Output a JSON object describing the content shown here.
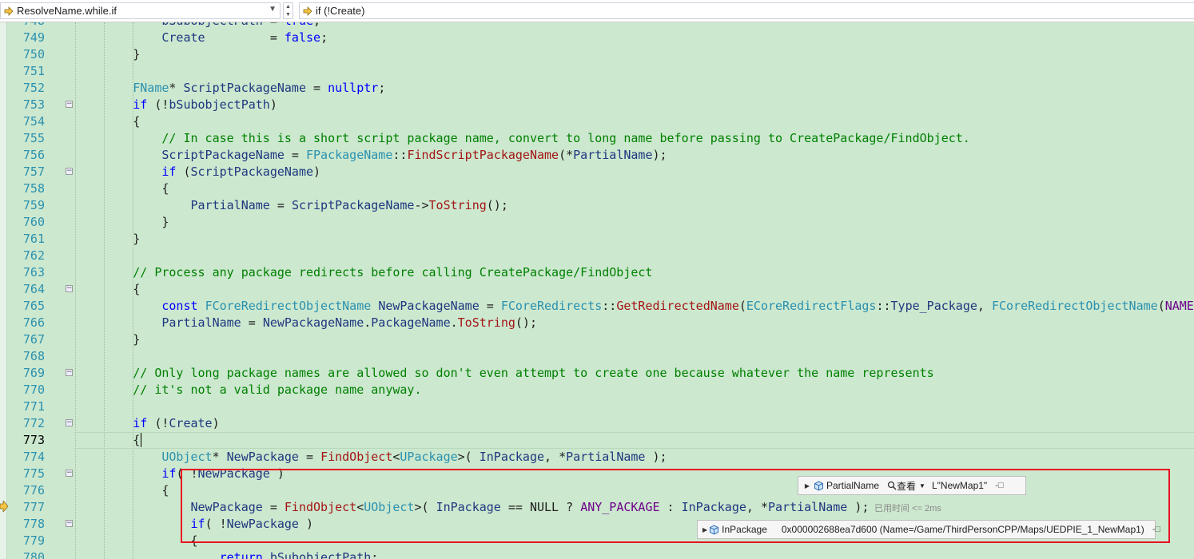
{
  "navbar": {
    "scope_combo": "ResolveName.while.if",
    "member_combo": "if (!Create)"
  },
  "code_lines": [
    {
      "num": "748",
      "cur": false,
      "fold": false,
      "segs": [
        [
          "",
          "            "
        ],
        [
          "va",
          "bSubobjectPath"
        ],
        [
          "",
          " = "
        ],
        [
          "kw",
          "true"
        ],
        [
          "",
          ";"
        ]
      ]
    },
    {
      "num": "749",
      "cur": false,
      "fold": false,
      "segs": [
        [
          "",
          "            "
        ],
        [
          "va",
          "Create"
        ],
        [
          "",
          "         = "
        ],
        [
          "kw",
          "false"
        ],
        [
          "",
          ";"
        ]
      ]
    },
    {
      "num": "750",
      "cur": false,
      "fold": false,
      "segs": [
        [
          "",
          "        }"
        ]
      ]
    },
    {
      "num": "751",
      "cur": false,
      "fold": false,
      "segs": []
    },
    {
      "num": "752",
      "cur": false,
      "fold": false,
      "segs": [
        [
          "",
          "        "
        ],
        [
          "ty",
          "FName"
        ],
        [
          "",
          "* "
        ],
        [
          "va",
          "ScriptPackageName"
        ],
        [
          "",
          " = "
        ],
        [
          "kw",
          "nullptr"
        ],
        [
          "",
          ";"
        ]
      ]
    },
    {
      "num": "753",
      "cur": false,
      "fold": true,
      "segs": [
        [
          "",
          "        "
        ],
        [
          "kw",
          "if"
        ],
        [
          "",
          " (!"
        ],
        [
          "va",
          "bSubobjectPath"
        ],
        [
          "",
          ")"
        ]
      ]
    },
    {
      "num": "754",
      "cur": false,
      "fold": false,
      "segs": [
        [
          "",
          "        {"
        ]
      ]
    },
    {
      "num": "755",
      "cur": false,
      "fold": false,
      "segs": [
        [
          "",
          "            "
        ],
        [
          "cm",
          "// In case this is a short script package name, convert to long name before passing to CreatePackage/FindObject."
        ]
      ]
    },
    {
      "num": "756",
      "cur": false,
      "fold": false,
      "segs": [
        [
          "",
          "            "
        ],
        [
          "va",
          "ScriptPackageName"
        ],
        [
          "",
          " = "
        ],
        [
          "ty",
          "FPackageName"
        ],
        [
          "",
          "::"
        ],
        [
          "fn",
          "FindScriptPackageName"
        ],
        [
          "",
          "(*"
        ],
        [
          "va",
          "PartialName"
        ],
        [
          "",
          ");"
        ]
      ]
    },
    {
      "num": "757",
      "cur": false,
      "fold": true,
      "segs": [
        [
          "",
          "            "
        ],
        [
          "kw",
          "if"
        ],
        [
          "",
          " ("
        ],
        [
          "va",
          "ScriptPackageName"
        ],
        [
          "",
          ")"
        ]
      ]
    },
    {
      "num": "758",
      "cur": false,
      "fold": false,
      "segs": [
        [
          "",
          "            {"
        ]
      ]
    },
    {
      "num": "759",
      "cur": false,
      "fold": false,
      "segs": [
        [
          "",
          "                "
        ],
        [
          "va",
          "PartialName"
        ],
        [
          "",
          " = "
        ],
        [
          "va",
          "ScriptPackageName"
        ],
        [
          "",
          "->"
        ],
        [
          "fn",
          "ToString"
        ],
        [
          "",
          "();"
        ]
      ]
    },
    {
      "num": "760",
      "cur": false,
      "fold": false,
      "segs": [
        [
          "",
          "            }"
        ]
      ]
    },
    {
      "num": "761",
      "cur": false,
      "fold": false,
      "segs": [
        [
          "",
          "        }"
        ]
      ]
    },
    {
      "num": "762",
      "cur": false,
      "fold": false,
      "segs": []
    },
    {
      "num": "763",
      "cur": false,
      "fold": false,
      "segs": [
        [
          "",
          "        "
        ],
        [
          "cm",
          "// Process any package redirects before calling CreatePackage/FindObject"
        ]
      ]
    },
    {
      "num": "764",
      "cur": false,
      "fold": true,
      "segs": [
        [
          "",
          "        {"
        ]
      ]
    },
    {
      "num": "765",
      "cur": false,
      "fold": false,
      "segs": [
        [
          "",
          "            "
        ],
        [
          "kw",
          "const"
        ],
        [
          "",
          " "
        ],
        [
          "ty",
          "FCoreRedirectObjectName"
        ],
        [
          "",
          " "
        ],
        [
          "va",
          "NewPackageName"
        ],
        [
          "",
          " = "
        ],
        [
          "ty",
          "FCoreRedirects"
        ],
        [
          "",
          "::"
        ],
        [
          "fn",
          "GetRedirectedName"
        ],
        [
          "",
          "("
        ],
        [
          "ty",
          "ECoreRedirectFlags"
        ],
        [
          "",
          "::"
        ],
        [
          "va",
          "Type_Package"
        ],
        [
          "",
          ", "
        ],
        [
          "ty",
          "FCoreRedirectObjectName"
        ],
        [
          "",
          "("
        ],
        [
          "mc",
          "NAME_"
        ]
      ]
    },
    {
      "num": "766",
      "cur": false,
      "fold": false,
      "segs": [
        [
          "",
          "            "
        ],
        [
          "va",
          "PartialName"
        ],
        [
          "",
          " = "
        ],
        [
          "va",
          "NewPackageName"
        ],
        [
          "",
          "."
        ],
        [
          "va",
          "PackageName"
        ],
        [
          "",
          "."
        ],
        [
          "fn",
          "ToString"
        ],
        [
          "",
          "();"
        ]
      ]
    },
    {
      "num": "767",
      "cur": false,
      "fold": false,
      "segs": [
        [
          "",
          "        }"
        ]
      ]
    },
    {
      "num": "768",
      "cur": false,
      "fold": false,
      "segs": []
    },
    {
      "num": "769",
      "cur": false,
      "fold": true,
      "segs": [
        [
          "",
          "        "
        ],
        [
          "cm",
          "// Only long package names are allowed so don't even attempt to create one because whatever the name represents"
        ]
      ]
    },
    {
      "num": "770",
      "cur": false,
      "fold": false,
      "segs": [
        [
          "",
          "        "
        ],
        [
          "cm",
          "// it's not a valid package name anyway."
        ]
      ]
    },
    {
      "num": "771",
      "cur": false,
      "fold": false,
      "segs": []
    },
    {
      "num": "772",
      "cur": false,
      "fold": true,
      "segs": [
        [
          "",
          "        "
        ],
        [
          "kw",
          "if"
        ],
        [
          "",
          " (!"
        ],
        [
          "va",
          "Create"
        ],
        [
          "",
          ")"
        ]
      ]
    },
    {
      "num": "773",
      "cur": true,
      "fold": false,
      "segs": [
        [
          "",
          "        {"
        ]
      ]
    },
    {
      "num": "774",
      "cur": false,
      "fold": false,
      "segs": [
        [
          "",
          "            "
        ],
        [
          "ty",
          "UObject"
        ],
        [
          "",
          "* "
        ],
        [
          "va",
          "NewPackage"
        ],
        [
          "",
          " = "
        ],
        [
          "fn",
          "FindObject"
        ],
        [
          "",
          "<"
        ],
        [
          "ty",
          "UPackage"
        ],
        [
          "",
          ">( "
        ],
        [
          "va",
          "InPackage"
        ],
        [
          "",
          ", *"
        ],
        [
          "va",
          "PartialName"
        ],
        [
          "",
          " );"
        ]
      ]
    },
    {
      "num": "775",
      "cur": false,
      "fold": true,
      "segs": [
        [
          "",
          "            "
        ],
        [
          "kw",
          "if"
        ],
        [
          "",
          "( !"
        ],
        [
          "va",
          "NewPackage"
        ],
        [
          "",
          " )"
        ]
      ]
    },
    {
      "num": "776",
      "cur": false,
      "fold": false,
      "segs": [
        [
          "",
          "            {"
        ]
      ]
    },
    {
      "num": "777",
      "cur": false,
      "fold": false,
      "segs": [
        [
          "",
          "                "
        ],
        [
          "va",
          "NewPackage"
        ],
        [
          "",
          " = "
        ],
        [
          "fn",
          "FindObject"
        ],
        [
          "",
          "<"
        ],
        [
          "ty",
          "UObject"
        ],
        [
          "",
          ">( "
        ],
        [
          "va",
          "InPackage"
        ],
        [
          "",
          " == NULL ? "
        ],
        [
          "mc",
          "ANY_PACKAGE"
        ],
        [
          "",
          " : "
        ],
        [
          "va",
          "InPackage"
        ],
        [
          "",
          ", *"
        ],
        [
          "va",
          "PartialName"
        ],
        [
          "",
          " );"
        ]
      ]
    },
    {
      "num": "778",
      "cur": false,
      "fold": true,
      "segs": [
        [
          "",
          "                "
        ],
        [
          "kw",
          "if"
        ],
        [
          "",
          "( !"
        ],
        [
          "va",
          "NewPackage"
        ],
        [
          "",
          " )"
        ]
      ]
    },
    {
      "num": "779",
      "cur": false,
      "fold": false,
      "segs": [
        [
          "",
          "                {"
        ]
      ]
    },
    {
      "num": "780",
      "cur": false,
      "fold": false,
      "segs": [
        [
          "",
          "                    "
        ],
        [
          "kw",
          "return"
        ],
        [
          "",
          " "
        ],
        [
          "va",
          "bSubobjectPath"
        ],
        [
          "",
          ";"
        ]
      ]
    }
  ],
  "datatips": {
    "partialname": {
      "name": "PartialName",
      "view_label": "查看",
      "value": "L\"NewMap1\""
    },
    "inpackage": {
      "name": "InPackage",
      "value": "0x000002688ea7d600 (Name=/Game/ThirdPersonCPP/Maps/UEDPIE_1_NewMap1)"
    }
  },
  "perf_tip": "已用时间 <= 2ms",
  "colors": {
    "editor_background": "#cce8cf",
    "keyword": "#0000ff",
    "type": "#2b91af",
    "comment": "#008000",
    "function": "#a31515",
    "variable": "#1f377f",
    "highlight_box": "#e81123"
  }
}
